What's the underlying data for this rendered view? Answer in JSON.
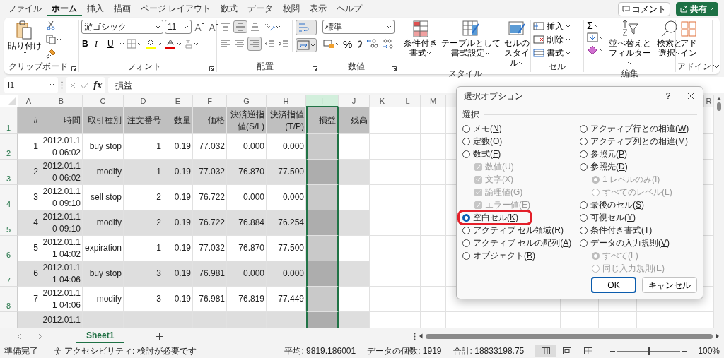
{
  "tabs": [
    {
      "label": "ファイル",
      "selected": false
    },
    {
      "label": "ホーム",
      "selected": true
    },
    {
      "label": "挿入",
      "selected": false
    },
    {
      "label": "描画",
      "selected": false
    },
    {
      "label": "ページ レイアウト",
      "selected": false
    },
    {
      "label": "数式",
      "selected": false
    },
    {
      "label": "データ",
      "selected": false
    },
    {
      "label": "校閲",
      "selected": false
    },
    {
      "label": "表示",
      "selected": false
    },
    {
      "label": "ヘルプ",
      "selected": false
    }
  ],
  "comment_button": "コメント",
  "share_button": "共有",
  "ribbon": {
    "clipboard": {
      "paste": "貼り付け",
      "label": "クリップボード"
    },
    "font": {
      "font_name": "游ゴシック",
      "font_size": "11",
      "bold": "B",
      "italic": "I",
      "underline": "U",
      "label": "フォント"
    },
    "alignment": {
      "label": "配置",
      "top_row_pressed": [
        false,
        true,
        false
      ],
      "bottom_row_pressed": [
        false,
        false,
        true,
        false,
        false
      ],
      "wrap_text_pressed": true,
      "merge_pressed": true
    },
    "number": {
      "format": "標準",
      "percent": "%",
      "label": "数値"
    },
    "styles": {
      "conditional": "条件付き書式",
      "table": "テーブルとして書式設定",
      "cell_styles": "セルのスタイル",
      "label": "スタイル"
    },
    "cells": {
      "insert": "挿入",
      "delete": "削除",
      "format": "書式",
      "label": "セル"
    },
    "editing": {
      "autosum": "Σ",
      "sort_filter": "並べ替えとフィルター",
      "find_select": "検索と選択",
      "label": "編集"
    },
    "addins": {
      "addins": "アドイン",
      "label": "アドイン"
    }
  },
  "formula_bar": {
    "name_box": "I1",
    "function_label": "fx",
    "value": "損益"
  },
  "sheet": {
    "columns": [
      {
        "letter": "A",
        "selected": false
      },
      {
        "letter": "B",
        "selected": false
      },
      {
        "letter": "C",
        "selected": false
      },
      {
        "letter": "D",
        "selected": false
      },
      {
        "letter": "E",
        "selected": false
      },
      {
        "letter": "F",
        "selected": false
      },
      {
        "letter": "G",
        "selected": false
      },
      {
        "letter": "H",
        "selected": false
      },
      {
        "letter": "I",
        "selected": true
      },
      {
        "letter": "J",
        "selected": false
      },
      {
        "letter": "K",
        "selected": false
      },
      {
        "letter": "L",
        "selected": false
      },
      {
        "letter": "M",
        "selected": false
      },
      {
        "letter": "R",
        "selected": false,
        "gap_before": true
      }
    ],
    "rows": [
      {
        "number": "1",
        "heading": true,
        "cells": [
          "#",
          "時間",
          "取引種別",
          "注文番号",
          "数量",
          "価格",
          "決済逆指値(S/L)",
          "決済指値(T/P)",
          "損益",
          "残高"
        ]
      },
      {
        "number": "2",
        "shaded": false,
        "cells": [
          "1",
          "2012.01.1\n0 06:02",
          "buy stop",
          "1",
          "0.19",
          "77.032",
          "0.000",
          "0.000"
        ]
      },
      {
        "number": "3",
        "shaded": true,
        "cells": [
          "2",
          "2012.01.1\n0 06:02",
          "modify",
          "1",
          "0.19",
          "77.032",
          "76.870",
          "77.500"
        ]
      },
      {
        "number": "4",
        "shaded": false,
        "cells": [
          "3",
          "2012.01.1\n0 09:10",
          "sell stop",
          "2",
          "0.19",
          "76.722",
          "0.000",
          "0.000"
        ]
      },
      {
        "number": "5",
        "shaded": true,
        "cells": [
          "4",
          "2012.01.1\n0 09:10",
          "modify",
          "2",
          "0.19",
          "76.722",
          "76.884",
          "76.254"
        ]
      },
      {
        "number": "6",
        "shaded": false,
        "cells": [
          "5",
          "2012.01.1\n1 04:02",
          "expiration",
          "1",
          "0.19",
          "77.032",
          "76.870",
          "77.500"
        ]
      },
      {
        "number": "7",
        "shaded": true,
        "cells": [
          "6",
          "2012.01.1\n1 04:06",
          "buy stop",
          "3",
          "0.19",
          "76.981",
          "0.000",
          "0.000"
        ]
      },
      {
        "number": "8",
        "shaded": false,
        "cells": [
          "7",
          "2012.01.1\n1 04:06",
          "modify",
          "3",
          "0.19",
          "76.981",
          "76.819",
          "77.449"
        ]
      },
      {
        "shaded": true,
        "cells": [
          null,
          "2012.01.1"
        ]
      }
    ]
  },
  "dialog": {
    "title": "選択オプション",
    "help": "?",
    "group_label": "選択",
    "left_options": [
      {
        "label": "メモ(N)",
        "kind": "radio",
        "selected": false,
        "disabled": false
      },
      {
        "label": "定数(O)",
        "kind": "radio",
        "selected": false,
        "disabled": false
      },
      {
        "label": "数式(F)",
        "kind": "radio",
        "selected": false,
        "disabled": false,
        "children": [
          {
            "label": "数値(U)",
            "kind": "checkbox",
            "checked": true,
            "disabled": true
          },
          {
            "label": "文字(X)",
            "kind": "checkbox",
            "checked": true,
            "disabled": true
          },
          {
            "label": "論理値(G)",
            "kind": "checkbox",
            "checked": true,
            "disabled": true
          },
          {
            "label": "エラー値(E)",
            "kind": "checkbox",
            "checked": true,
            "disabled": true
          }
        ]
      },
      {
        "label": "空白セル(K)",
        "kind": "radio",
        "selected": true,
        "disabled": false,
        "highlighted": true
      },
      {
        "label": "アクティブ セル領域(R)",
        "kind": "radio",
        "selected": false,
        "disabled": false
      },
      {
        "label": "アクティブ セルの配列(A)",
        "kind": "radio",
        "selected": false,
        "disabled": false
      },
      {
        "label": "オブジェクト(B)",
        "kind": "radio",
        "selected": false,
        "disabled": false
      }
    ],
    "right_options": [
      {
        "label": "アクティブ行との相違(W)",
        "kind": "radio",
        "selected": false,
        "disabled": false
      },
      {
        "label": "アクティブ列との相違(M)",
        "kind": "radio",
        "selected": false,
        "disabled": false
      },
      {
        "label": "参照元(P)",
        "kind": "radio",
        "selected": false,
        "disabled": false
      },
      {
        "label": "参照先(D)",
        "kind": "radio",
        "selected": false,
        "disabled": false,
        "children": [
          {
            "label": "1 レベルのみ(I)",
            "kind": "radio",
            "selected": true,
            "disabled": true
          },
          {
            "label": "すべてのレベル(L)",
            "kind": "radio",
            "selected": false,
            "disabled": true
          }
        ]
      },
      {
        "label": "最後のセル(S)",
        "kind": "radio",
        "selected": false,
        "disabled": false
      },
      {
        "label": "可視セル(Y)",
        "kind": "radio",
        "selected": false,
        "disabled": false
      },
      {
        "label": "条件付き書式(T)",
        "kind": "radio",
        "selected": false,
        "disabled": false
      },
      {
        "label": "データの入力規則(V)",
        "kind": "radio",
        "selected": false,
        "disabled": false,
        "children": [
          {
            "label": "すべて(L)",
            "kind": "radio",
            "selected": true,
            "disabled": true
          },
          {
            "label": "同じ入力規則(E)",
            "kind": "radio",
            "selected": false,
            "disabled": true
          }
        ]
      }
    ],
    "ok": "OK",
    "cancel": "キャンセル"
  },
  "sheet_tabs": [
    {
      "label": "Sheet1",
      "selected": true
    }
  ],
  "status_bar": {
    "ready": "準備完了",
    "accessibility": "アクセシビリティ: 検討が必要です",
    "average": "平均: 9819.186001",
    "count": "データの個数: 1919",
    "sum": "合計: 18833198.75",
    "views": [
      {
        "selected": true
      },
      {
        "selected": false
      },
      {
        "selected": false
      }
    ],
    "zoom": {
      "level": 0.5,
      "reading": "100%"
    }
  }
}
